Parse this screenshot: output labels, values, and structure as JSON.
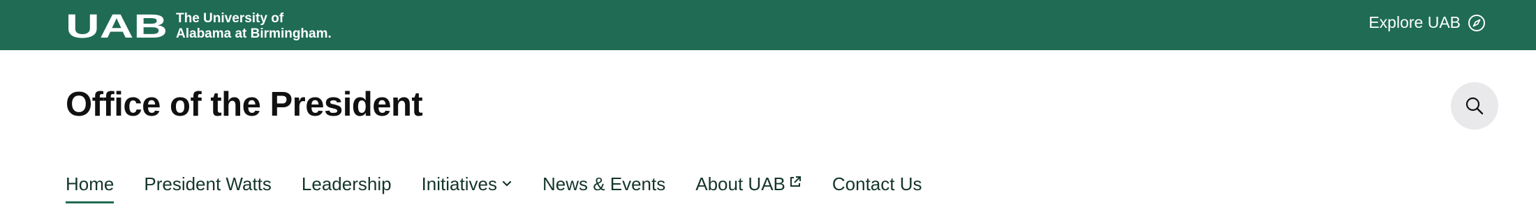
{
  "header": {
    "logo_text": "UAB",
    "university_line1": "The University of",
    "university_line2": "Alabama at Birmingham.",
    "explore_label": "Explore UAB",
    "explore_icon": "compass-icon",
    "brand_color": "#1f6b53"
  },
  "site": {
    "title": "Office of the President",
    "search_icon": "search-icon"
  },
  "nav": {
    "items": [
      {
        "label": "Home",
        "active": true
      },
      {
        "label": "President Watts"
      },
      {
        "label": "Leadership"
      },
      {
        "label": "Initiatives",
        "icon": "chevron-down-icon"
      },
      {
        "label": "News & Events"
      },
      {
        "label": "About UAB",
        "icon": "external-link-icon"
      },
      {
        "label": "Contact Us"
      }
    ]
  }
}
